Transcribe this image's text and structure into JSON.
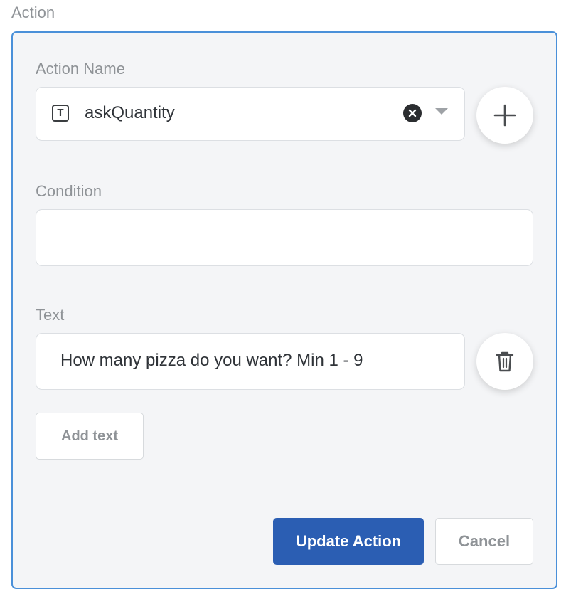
{
  "section": {
    "title": "Action"
  },
  "action_name": {
    "label": "Action Name",
    "value": "askQuantity",
    "type_icon_glyph": "T",
    "type_icon": "text-type-icon",
    "clear_icon": "clear-icon",
    "dropdown_icon": "chevron-down-icon",
    "add_icon": "plus-icon"
  },
  "condition": {
    "label": "Condition",
    "value": ""
  },
  "text": {
    "label": "Text",
    "items": [
      "How many pizza do you want? Min 1 - 9"
    ],
    "delete_icon": "trash-icon",
    "add_label": "Add text"
  },
  "footer": {
    "primary_label": "Update Action",
    "cancel_label": "Cancel"
  },
  "colors": {
    "accent_border": "#4a90d9",
    "primary_button": "#2b5eb3",
    "panel_background": "#f4f5f7",
    "label_text": "#8f9397"
  }
}
